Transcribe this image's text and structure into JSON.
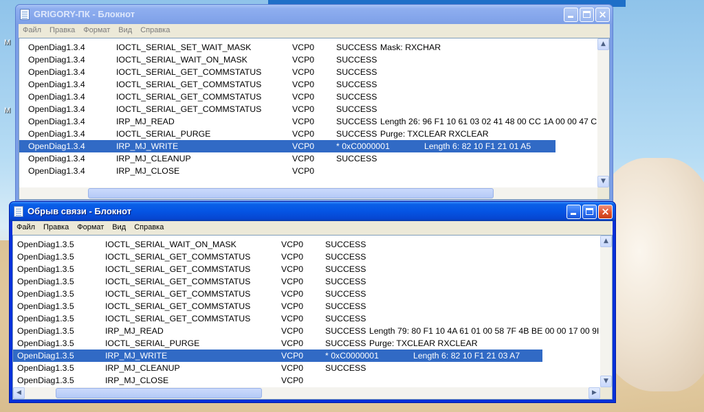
{
  "desktop": {
    "label_1": "М",
    "label_2": "М"
  },
  "window_back": {
    "title": "GRIGORY-ПК - Блокнот",
    "menu": [
      "Файл",
      "Правка",
      "Формат",
      "Вид",
      "Справка"
    ],
    "rows": [
      {
        "proc": "OpenDiag1.3.4",
        "op": "IOCTL_SERIAL_SET_WAIT_MASK",
        "dev": "VCP0",
        "result": "SUCCESS",
        "detail": "Mask: RXCHAR"
      },
      {
        "proc": "OpenDiag1.3.4",
        "op": "IOCTL_SERIAL_WAIT_ON_MASK",
        "dev": "VCP0",
        "result": "SUCCESS",
        "detail": ""
      },
      {
        "proc": "OpenDiag1.3.4",
        "op": "IOCTL_SERIAL_GET_COMMSTATUS",
        "dev": "VCP0",
        "result": "SUCCESS",
        "detail": ""
      },
      {
        "proc": "OpenDiag1.3.4",
        "op": "IOCTL_SERIAL_GET_COMMSTATUS",
        "dev": "VCP0",
        "result": "SUCCESS",
        "detail": ""
      },
      {
        "proc": "OpenDiag1.3.4",
        "op": "IOCTL_SERIAL_GET_COMMSTATUS",
        "dev": "VCP0",
        "result": "SUCCESS",
        "detail": ""
      },
      {
        "proc": "OpenDiag1.3.4",
        "op": "IOCTL_SERIAL_GET_COMMSTATUS",
        "dev": "VCP0",
        "result": "SUCCESS",
        "detail": ""
      },
      {
        "proc": "OpenDiag1.3.4",
        "op": "IRP_MJ_READ",
        "dev": "VCP0",
        "result": "SUCCESS",
        "detail": "Length 26: 96 F1 10 61 03 02 41 48 00 CC 1A 00 00 47 C"
      },
      {
        "proc": "OpenDiag1.3.4",
        "op": "IOCTL_SERIAL_PURGE",
        "dev": "VCP0",
        "result": "SUCCESS",
        "detail": "Purge: TXCLEAR RXCLEAR"
      },
      {
        "proc": "OpenDiag1.3.4",
        "op": "IRP_MJ_WRITE",
        "dev": "VCP0",
        "result": "* 0xC0000001",
        "detail": "Length 6: 82 10 F1 21 01 A5",
        "selected": true
      },
      {
        "proc": "OpenDiag1.3.4",
        "op": "IRP_MJ_CLEANUP",
        "dev": "VCP0",
        "result": "SUCCESS",
        "detail": ""
      },
      {
        "proc": "OpenDiag1.3.4",
        "op": "IRP_MJ_CLOSE",
        "dev": "VCP0",
        "result": "",
        "detail": ""
      }
    ]
  },
  "window_front": {
    "title": "Обрыв связи - Блокнот",
    "menu": [
      "Файл",
      "Правка",
      "Формат",
      "Вид",
      "Справка"
    ],
    "rows": [
      {
        "proc": "OpenDiag1.3.5",
        "op": "IOCTL_SERIAL_WAIT_ON_MASK",
        "dev": "VCP0",
        "result": "SUCCESS",
        "detail": ""
      },
      {
        "proc": "OpenDiag1.3.5",
        "op": "IOCTL_SERIAL_GET_COMMSTATUS",
        "dev": "VCP0",
        "result": "SUCCESS",
        "detail": ""
      },
      {
        "proc": "OpenDiag1.3.5",
        "op": "IOCTL_SERIAL_GET_COMMSTATUS",
        "dev": "VCP0",
        "result": "SUCCESS",
        "detail": ""
      },
      {
        "proc": "OpenDiag1.3.5",
        "op": "IOCTL_SERIAL_GET_COMMSTATUS",
        "dev": "VCP0",
        "result": "SUCCESS",
        "detail": ""
      },
      {
        "proc": "OpenDiag1.3.5",
        "op": "IOCTL_SERIAL_GET_COMMSTATUS",
        "dev": "VCP0",
        "result": "SUCCESS",
        "detail": ""
      },
      {
        "proc": "OpenDiag1.3.5",
        "op": "IOCTL_SERIAL_GET_COMMSTATUS",
        "dev": "VCP0",
        "result": "SUCCESS",
        "detail": ""
      },
      {
        "proc": "OpenDiag1.3.5",
        "op": "IOCTL_SERIAL_GET_COMMSTATUS",
        "dev": "VCP0",
        "result": "SUCCESS",
        "detail": ""
      },
      {
        "proc": "OpenDiag1.3.5",
        "op": "IRP_MJ_READ",
        "dev": "VCP0",
        "result": "SUCCESS",
        "detail": "Length 79: 80 F1 10 4A 61 01 00 58 7F 4B BE 00 00 17 00 9I"
      },
      {
        "proc": "OpenDiag1.3.5",
        "op": "IOCTL_SERIAL_PURGE",
        "dev": "VCP0",
        "result": "SUCCESS",
        "detail": "Purge: TXCLEAR RXCLEAR"
      },
      {
        "proc": "OpenDiag1.3.5",
        "op": "IRP_MJ_WRITE",
        "dev": "VCP0",
        "result": "* 0xC0000001",
        "detail": "Length 6: 82 10 F1 21 03 A7",
        "selected": true
      },
      {
        "proc": "OpenDiag1.3.5",
        "op": "IRP_MJ_CLEANUP",
        "dev": "VCP0",
        "result": "SUCCESS",
        "detail": ""
      },
      {
        "proc": "OpenDiag1.3.5",
        "op": "IRP_MJ_CLOSE",
        "dev": "VCP0",
        "result": "",
        "detail": ""
      }
    ]
  },
  "icons": {
    "up": "scroll-up-arrow",
    "down": "scroll-down-arrow",
    "left": "scroll-left-arrow",
    "right": "scroll-right-arrow",
    "minimize": "minimize-icon",
    "maximize": "maximize-icon",
    "close": "close-icon",
    "app": "notepad-icon"
  }
}
